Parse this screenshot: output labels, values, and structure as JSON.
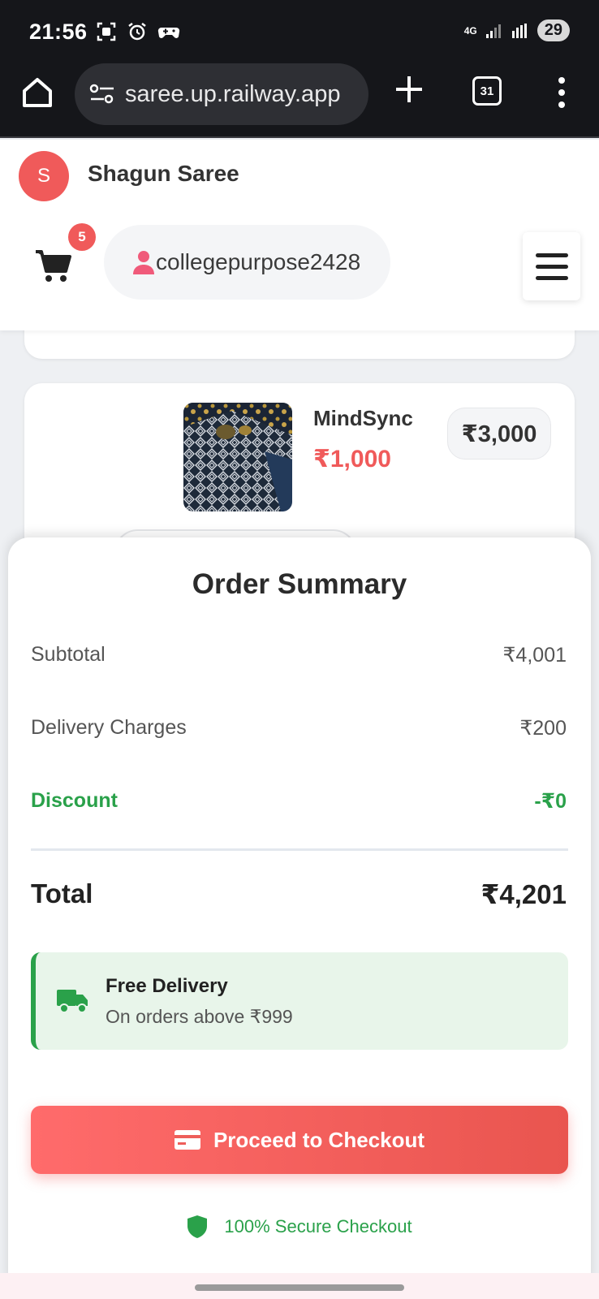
{
  "status_bar": {
    "time": "21:56",
    "network": "4G",
    "battery": "29",
    "icons": [
      "screenshot-icon",
      "alarm-icon",
      "game-controller-icon",
      "signal-icon",
      "signal-roaming-icon"
    ]
  },
  "browser": {
    "url": "saree.up.railway.app",
    "tab_count": "31"
  },
  "site": {
    "logo_letter": "S",
    "brand": "Shagun Saree",
    "cart_count": "5",
    "username": "collegepurpose2428"
  },
  "cart_item": {
    "name": "MindSync",
    "price": "₹1,000",
    "line_total": "₹3,000"
  },
  "summary": {
    "title": "Order Summary",
    "subtotal_label": "Subtotal",
    "subtotal_value": "₹4,001",
    "delivery_label": "Delivery Charges",
    "delivery_value": "₹200",
    "discount_label": "Discount",
    "discount_value": "-₹0",
    "total_label": "Total",
    "total_value": "₹4,201"
  },
  "delivery_notice": {
    "title": "Free Delivery",
    "subtitle": "On orders above ₹999"
  },
  "checkout": {
    "button_label": "Proceed to Checkout",
    "secure_text": "100% Secure Checkout"
  },
  "colors": {
    "accent": "#f05a5a",
    "success": "#2aa14a",
    "dark": "#15161a"
  }
}
